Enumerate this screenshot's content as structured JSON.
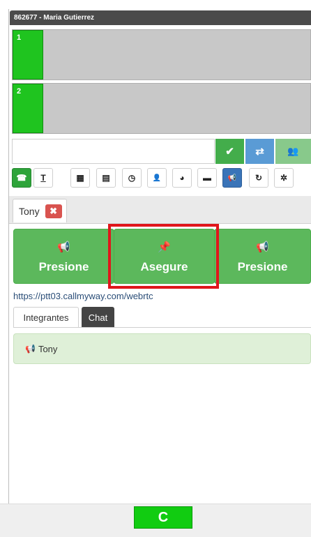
{
  "header": {
    "title": "862677 - Maria Gutierrez"
  },
  "lines": [
    {
      "number": "1"
    },
    {
      "number": "2"
    }
  ],
  "dial": {
    "value": "",
    "placeholder": ""
  },
  "dial_actions": {
    "confirm_icon": "✔",
    "transfer_icon": "⇄",
    "conference_icon": "👥"
  },
  "toolbar": {
    "items": [
      {
        "name": "phone-icon",
        "glyph": "☎"
      },
      {
        "name": "text-icon",
        "glyph": "T"
      },
      {
        "name": "keypad-icon",
        "glyph": "▦"
      },
      {
        "name": "list-icon",
        "glyph": "▤"
      },
      {
        "name": "clock-icon",
        "glyph": "◷"
      },
      {
        "name": "contact-icon",
        "glyph": "👤"
      },
      {
        "name": "globe-icon",
        "glyph": "◕"
      },
      {
        "name": "chat-icon",
        "glyph": "▬"
      },
      {
        "name": "megaphone-icon",
        "glyph": "📢"
      },
      {
        "name": "share-icon",
        "glyph": "↻"
      },
      {
        "name": "settings-icon",
        "glyph": "✲"
      }
    ]
  },
  "channel_tab": {
    "label": "Tony",
    "close_icon": "✖"
  },
  "ptt": {
    "buttons": [
      {
        "icon": "📢",
        "label": "Presione"
      },
      {
        "icon": "📌",
        "label": "Asegure"
      },
      {
        "icon": "📢",
        "label": "Presione"
      }
    ]
  },
  "server_url": "https://ptt03.callmyway.com/webrtc",
  "member_tabs": {
    "members_label": "Integrantes",
    "chat_label": "Chat"
  },
  "members": [
    {
      "name": "Tony",
      "icon": "📢"
    }
  ],
  "footer": {
    "refresh_icon": "C"
  },
  "colors": {
    "green": "#5cb85c",
    "line_green": "#1fc41f",
    "highlight": "#e0161b",
    "header": "#4b4b4b"
  }
}
